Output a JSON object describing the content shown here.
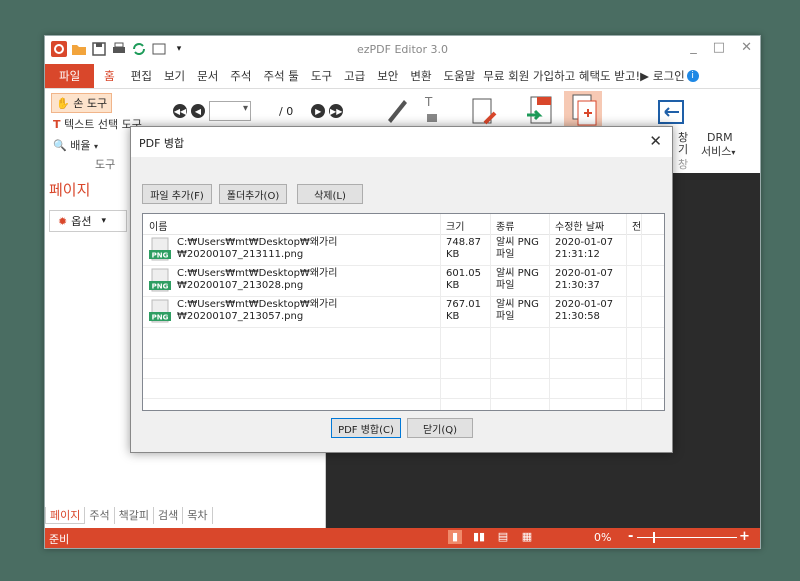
{
  "app": {
    "title": "ezPDF Editor 3.0",
    "window_controls": [
      "_",
      "□",
      "✕"
    ]
  },
  "menu": {
    "items": [
      "파일",
      "홈",
      "편집",
      "보기",
      "문서",
      "주석",
      "주석 툴",
      "도구",
      "고급",
      "보안",
      "변환",
      "도움말",
      "무료 회원 가입하고 혜택도 받고!▶",
      "로그인"
    ]
  },
  "ribbon": {
    "hand_tool": "손 도구",
    "text_select": "텍스트 선택 도구",
    "zoom_dropdown": "배율",
    "group_label": "도구",
    "page_total": "/ 0",
    "page_value": "",
    "side_label_top": "창",
    "side_label_mid": "기",
    "side_label_bot": "창",
    "drm_label_1": "DRM",
    "drm_label_2": "서비스"
  },
  "left_panel": {
    "title": "페이지",
    "options_button": "옵션",
    "tabs": [
      "페이지",
      "주석",
      "책갈피",
      "검색",
      "목차"
    ]
  },
  "status": {
    "text": "준비",
    "zoom": "0%",
    "zoom_minus": "-",
    "zoom_plus": "+"
  },
  "dialog": {
    "title": "PDF 병합",
    "close": "✕",
    "buttons": {
      "add_file": "파일 추가(F)",
      "add_folder": "폴더추가(O)",
      "delete": "삭제(L)",
      "merge": "PDF 병합(C)",
      "close": "닫기(Q)"
    },
    "columns": [
      "이름",
      "크기",
      "종류",
      "수정한 날짜",
      "전"
    ],
    "files": [
      {
        "path1": "C:₩Users₩mt₩Desktop₩왜가리",
        "path2": "₩20200107_213111.png",
        "size1": "748.87",
        "size2": "KB",
        "type1": "알씨 PNG",
        "type2": "파일",
        "date1": "2020-01-07",
        "date2": "21:31:12"
      },
      {
        "path1": "C:₩Users₩mt₩Desktop₩왜가리",
        "path2": "₩20200107_213028.png",
        "size1": "601.05",
        "size2": "KB",
        "type1": "알씨 PNG",
        "type2": "파일",
        "date1": "2020-01-07",
        "date2": "21:30:37"
      },
      {
        "path1": "C:₩Users₩mt₩Desktop₩왜가리",
        "path2": "₩20200107_213057.png",
        "size1": "767.01",
        "size2": "KB",
        "type1": "알씨 PNG",
        "type2": "파일",
        "date1": "2020-01-07",
        "date2": "21:30:58"
      }
    ],
    "png_badge": "PNG"
  }
}
